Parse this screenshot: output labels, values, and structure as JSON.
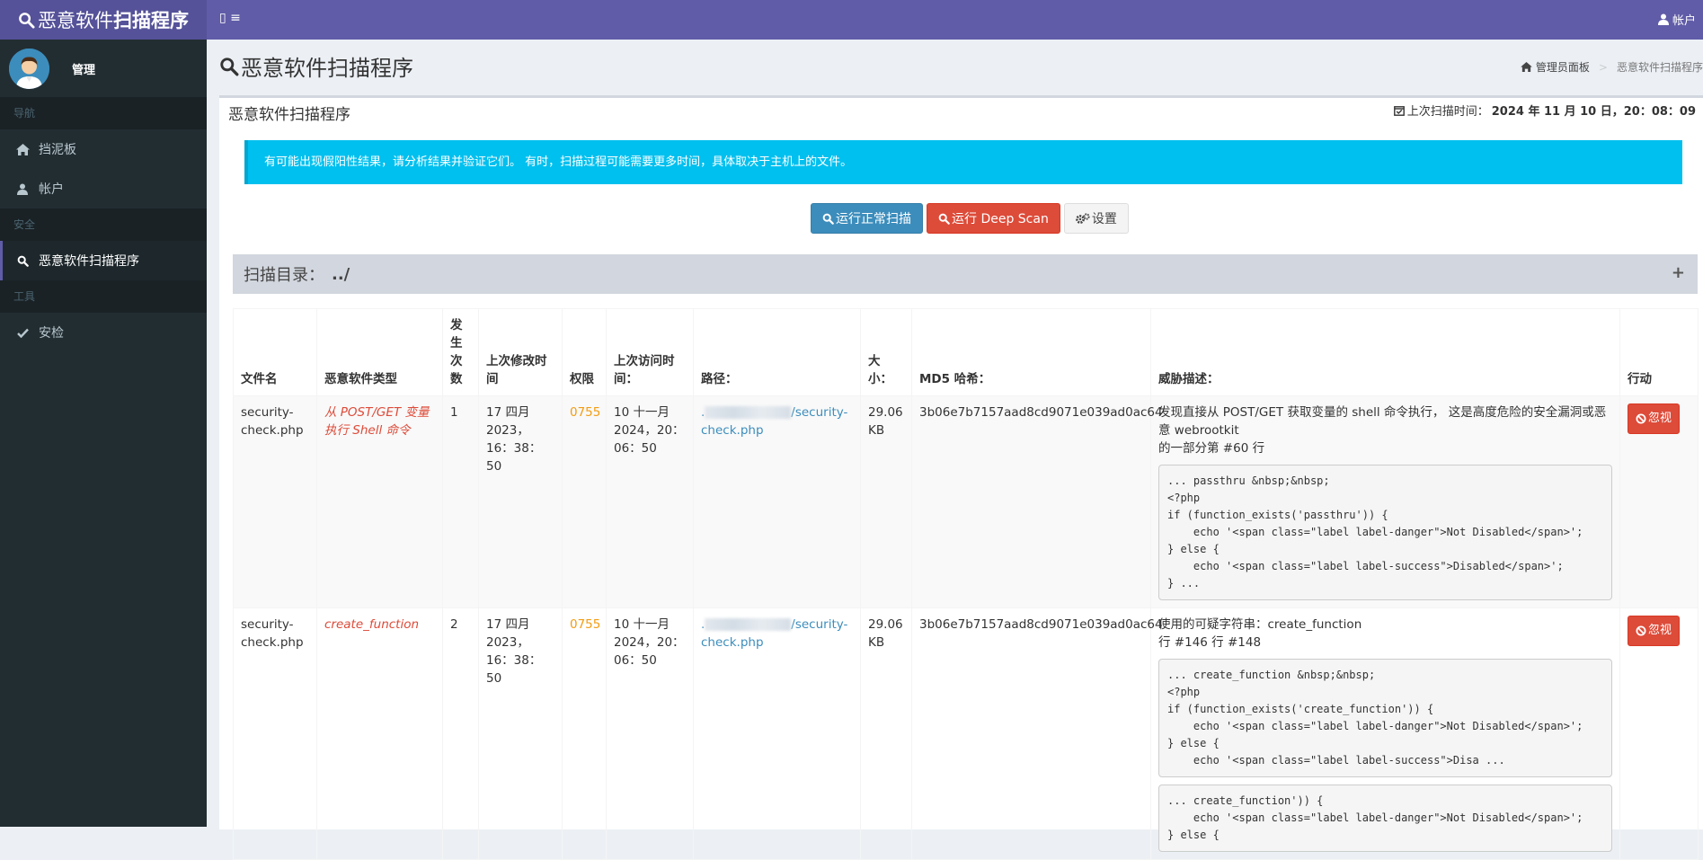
{
  "header": {
    "brand_light": "恶意软件",
    "brand_bold": "扫描程序",
    "toggle_label": "▯ ≡",
    "account_label": "帐户"
  },
  "sidebar": {
    "user_name": "管理",
    "sections": [
      {
        "header": "导航",
        "items": [
          {
            "label": "挡泥板",
            "icon": "home-icon"
          },
          {
            "label": "帐户",
            "icon": "user-icon"
          }
        ]
      },
      {
        "header": "安全",
        "items": [
          {
            "label": "恶意软件扫描程序",
            "icon": "search-icon",
            "active": true
          }
        ]
      },
      {
        "header": "工具",
        "items": [
          {
            "label": "安检",
            "icon": "check-icon"
          }
        ]
      }
    ]
  },
  "content": {
    "page_title": "恶意软件扫描程序",
    "breadcrumb": {
      "home": "管理员面板",
      "current": "恶意软件扫描程序"
    },
    "box_title": "恶意软件扫描程序",
    "last_scan_label": "上次扫描时间：",
    "last_scan_value": "2024 年 11 月 10 日，20：08：09",
    "alert": "有可能出现假阳性结果，请分析结果并验证它们。 有时，扫描过程可能需要更多时间，具体取决于主机上的文件。",
    "buttons": {
      "normal_scan": "运行正常扫描",
      "deep_scan": "运行 Deep Scan",
      "settings": "设置"
    },
    "scan_dir_label": "扫描目录：",
    "scan_dir_value": "../",
    "scan_dir_toggle": "+"
  },
  "table": {
    "headers": [
      "文件名",
      "恶意软件类型",
      "发生次数",
      "上次修改时间",
      "权限",
      "上次访问时间：",
      "路径：",
      "大小：",
      "MD5 哈希：",
      "威胁描述：",
      "行动"
    ],
    "rows": [
      {
        "filename": "security-check.php",
        "type": "从 POST/GET 变量执行 Shell 命令",
        "count": "1",
        "modified": "17 四月 2023，16：38：50",
        "perm": "0755",
        "accessed": "10 十一月 2024，20：06：50",
        "path_prefix": ".",
        "path_suffix": "/security-check.php",
        "size": "29.06 KB",
        "md5": "3b06e7b7157aad8cd9071e039ad0ac64",
        "desc": "发现直接从 POST/GET 获取变量的 shell 命令执行， 这是高度危险的安全漏洞或恶意 webrootkit",
        "desc_line": "的一部分第 #60 行",
        "code": [
          "... passthru &nbsp;&nbsp;\n<?php\nif (function_exists('passthru')) {\n    echo '<span class=\"label label-danger\">Not Disabled</span>';\n} else {\n    echo '<span class=\"label label-success\">Disabled</span>';\n} ..."
        ],
        "action": "忽视"
      },
      {
        "filename": "security-check.php",
        "type": "create_function",
        "count": "2",
        "modified": "17 四月 2023，16：38：50",
        "perm": "0755",
        "accessed": "10 十一月 2024，20：06：50",
        "path_prefix": ".",
        "path_suffix": "/security-check.php",
        "size": "29.06 KB",
        "md5": "3b06e7b7157aad8cd9071e039ad0ac64",
        "desc": "使用的可疑字符串：create_function",
        "desc_line": "行 #146 行 #148",
        "code": [
          "... create_function &nbsp;&nbsp;\n<?php\nif (function_exists('create_function')) {\n    echo '<span class=\"label label-danger\">Not Disabled</span>';\n} else {\n    echo '<span class=\"label label-success\">Disa ...",
          "... create_function')) {\n    echo '<span class=\"label label-danger\">Not Disabled</span>';\n} else {"
        ],
        "action": "忽视"
      }
    ]
  },
  "colors": {
    "header": "#605ca8",
    "sidebar": "#222d32",
    "alert": "#00c0ef",
    "primary": "#3c8dbc",
    "danger": "#dd4b39",
    "warning": "#f39c12"
  }
}
